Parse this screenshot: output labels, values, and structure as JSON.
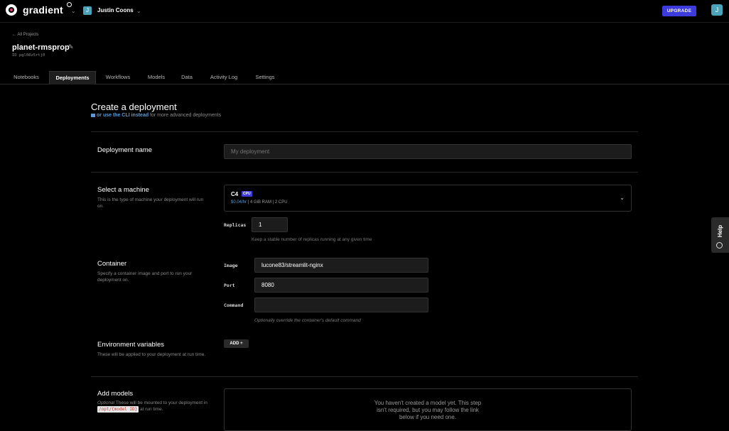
{
  "topbar": {
    "logo_text": "gradient",
    "team_avatar": "J",
    "team_name": "Justin Coons",
    "upgrade_label": "UPGRADE",
    "user_avatar": "J"
  },
  "project": {
    "back_link": "← All Projects",
    "name": "planet-rmsprop",
    "id_label": "ID",
    "id_value": "pgl08z5rtj0"
  },
  "tabs": [
    {
      "label": "Notebooks",
      "active": false
    },
    {
      "label": "Deployments",
      "active": true
    },
    {
      "label": "Workflows",
      "active": false
    },
    {
      "label": "Models",
      "active": false
    },
    {
      "label": "Data",
      "active": false
    },
    {
      "label": "Activity Log",
      "active": false
    },
    {
      "label": "Settings",
      "active": false
    }
  ],
  "page": {
    "title": "Create a deployment",
    "cli_link": "or use the CLI instead",
    "cli_suffix": " for more advanced deployments"
  },
  "deployment_name": {
    "title": "Deployment name",
    "placeholder": "My deployment"
  },
  "machine": {
    "title": "Select a machine",
    "desc": "This is the type of machine your deployment will run on.",
    "name": "C4",
    "badge": "CPU",
    "price": "$0.04/hr",
    "ram": "4 GiB RAM",
    "cpu": "2 CPU",
    "replicas_label": "Replicas",
    "replicas_value": "1",
    "replicas_help": "Keep a stable number of replicas running at any given time"
  },
  "container": {
    "title": "Container",
    "desc": "Specify a container image and port to run your deployment on.",
    "image_label": "Image",
    "image_value": "lucone83/streamlit-nginx",
    "port_label": "Port",
    "port_value": "8080",
    "command_label": "Command",
    "command_value": "",
    "command_help": "Optionally override the container's default command"
  },
  "env": {
    "title": "Environment variables",
    "desc": "These will be applied to your deployment at run time.",
    "add_label": "ADD +"
  },
  "models": {
    "title": "Add models",
    "desc_optional": "Optional",
    "desc_1": " These will be mounted to your deployment in ",
    "desc_path": "/opt/{model ID}",
    "desc_2": " at run time.",
    "empty_line1": "You haven't created a model yet. This step",
    "empty_line2": "isn't required, but you may follow the link",
    "empty_line3": "below if you need one."
  },
  "help": {
    "label": "Help"
  }
}
